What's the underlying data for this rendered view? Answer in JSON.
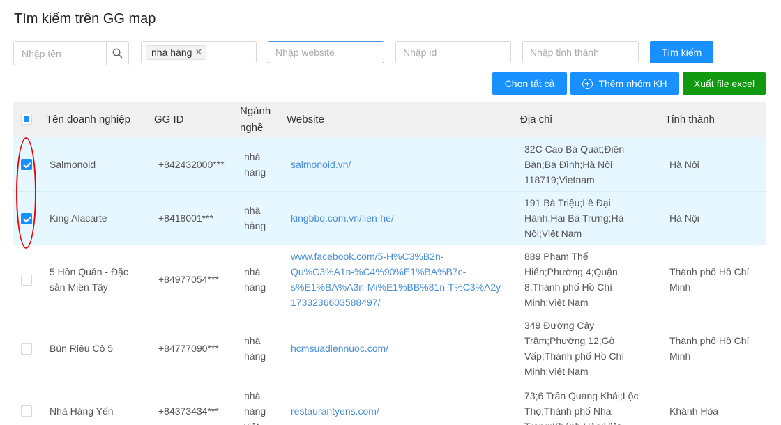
{
  "page": {
    "title": "Tìm kiếm trên GG map"
  },
  "filters": {
    "name_placeholder": "Nhập tên",
    "tag": "nhà hàng",
    "website_placeholder": "Nhập website",
    "id_placeholder": "Nhập id",
    "province_placeholder": "Nhập tỉnh thành",
    "search_button": "Tìm kiếm"
  },
  "actions": {
    "select_all": "Chọn tất cả",
    "add_group": "Thêm nhóm KH",
    "export_excel": "Xuất file excel"
  },
  "table": {
    "headers": {
      "name": "Tên doanh nghiệp",
      "gg_id": "GG ID",
      "industry_line1": "Ngành",
      "industry_line2": "nghề",
      "website": "Website",
      "address": "Địa chỉ",
      "province": "Tỉnh thành"
    },
    "rows": [
      {
        "checked": true,
        "name": [
          "Salmonoid"
        ],
        "gg_id": "+842432000***",
        "industry": [
          "nhà",
          "hàng"
        ],
        "website": [
          "salmonoid.vn/"
        ],
        "address": [
          "32C Cao Bá Quát;Điện",
          "Bàn;Ba Đình;Hà Nội",
          "118719;Vietnam"
        ],
        "province": [
          "Hà Nội"
        ]
      },
      {
        "checked": true,
        "name": [
          "King Alacarte"
        ],
        "gg_id": "+8418001***",
        "industry": [
          "nhà",
          "hàng"
        ],
        "website": [
          "kingbbq.com.vn/lien-he/"
        ],
        "address": [
          "191 Bà Triệu;Lê Đại",
          "Hành;Hai Bà Trưng;Hà",
          "Nội;Việt Nam"
        ],
        "province": [
          "Hà Nội"
        ]
      },
      {
        "checked": false,
        "name": [
          "5 Hòn Quán - Đặc",
          "sản Miền Tây"
        ],
        "gg_id": "+84977054***",
        "industry": [
          "nhà",
          "hàng"
        ],
        "website": [
          "www.facebook.com/5-H%C3%B2n-",
          "Qu%C3%A1n-%C4%90%E1%BA%B7c-",
          "s%E1%BA%A3n-Mi%E1%BB%81n-T%C3%A2y-",
          "1733236603588497/"
        ],
        "address": [
          "889 Phạm Thế",
          "Hiển;Phường 4;Quận",
          "8;Thành phố Hồ Chí",
          "Minh;Việt Nam"
        ],
        "province": [
          "Thành phố Hồ Chí",
          "Minh"
        ]
      },
      {
        "checked": false,
        "name": [
          "Bún Riêu Cô 5"
        ],
        "gg_id": "+84777090***",
        "industry": [
          "nhà",
          "hàng"
        ],
        "website": [
          "hcmsuadiennuoc.com/"
        ],
        "address": [
          "349 Đường Cây",
          "Trâm;Phường 12;Gò",
          "Vấp;Thành phố Hồ Chí",
          "Minh;Việt Nam"
        ],
        "province": [
          "Thành phố Hồ Chí",
          "Minh"
        ]
      },
      {
        "checked": false,
        "name": [
          "Nhà Hàng Yến"
        ],
        "gg_id": "+84373434***",
        "industry": [
          "nhà",
          "hàng",
          "việt"
        ],
        "website": [
          "restaurantyens.com/"
        ],
        "address": [
          "73;6 Trần Quang Khải;Lộc",
          "Thọ;Thành phố Nha",
          "Trang;Khánh Hòa;Việt"
        ],
        "province": [
          "Khánh Hòa"
        ]
      }
    ]
  },
  "colors": {
    "primary": "#1890ff",
    "success": "#0f9a0f",
    "selected_row": "#e6f7ff",
    "header_bg": "#f0f0f0",
    "link": "#4a8fd6",
    "annotation": "#e00000"
  }
}
